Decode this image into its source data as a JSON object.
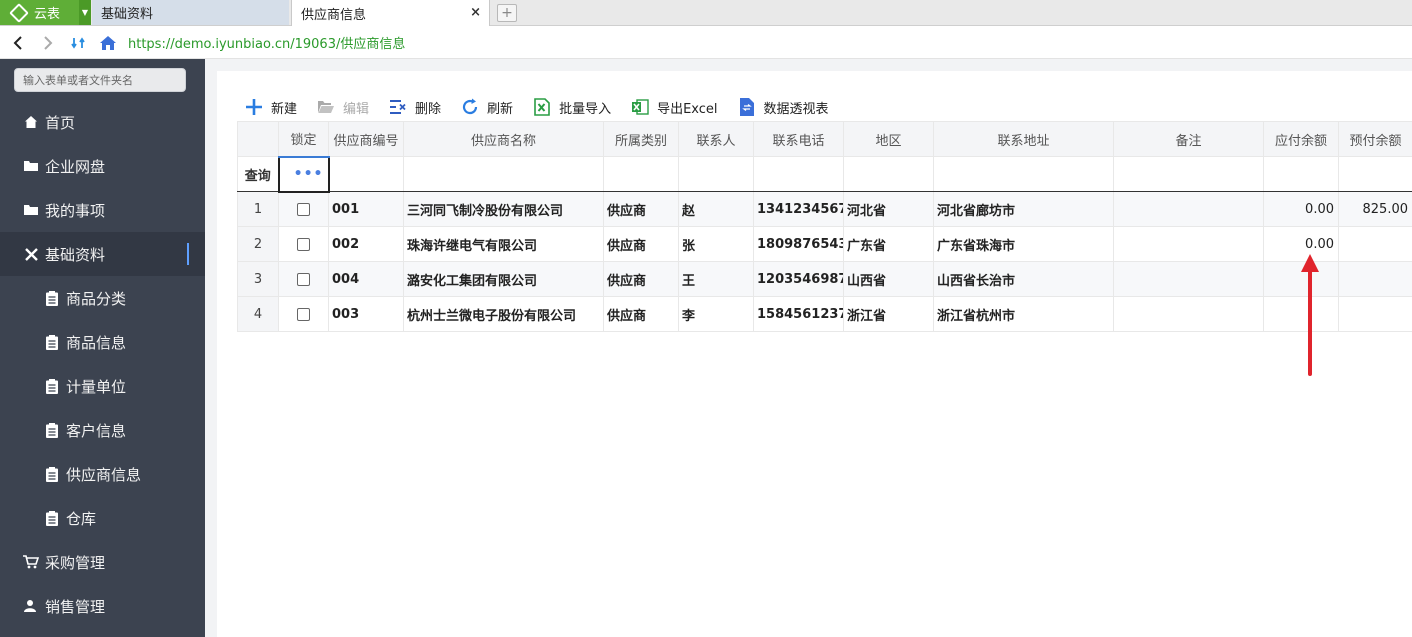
{
  "browser": {
    "app_tab_label": "云表",
    "tabs": [
      {
        "label": "基础资料"
      },
      {
        "label": "供应商信息"
      }
    ],
    "close_glyph": "×",
    "new_tab_glyph": "+",
    "url": "https://demo.iyunbiao.cn/19063/供应商信息"
  },
  "sidebar": {
    "search_placeholder": "输入表单或者文件夹名",
    "items": [
      {
        "label": "首页",
        "icon": "home-icon"
      },
      {
        "label": "企业网盘",
        "icon": "folder-icon"
      },
      {
        "label": "我的事项",
        "icon": "folder-icon"
      },
      {
        "label": "基础资料",
        "icon": "tools-icon"
      },
      {
        "label": "商品分类",
        "icon": "clipboard-icon"
      },
      {
        "label": "商品信息",
        "icon": "clipboard-icon"
      },
      {
        "label": "计量单位",
        "icon": "clipboard-icon"
      },
      {
        "label": "客户信息",
        "icon": "clipboard-icon"
      },
      {
        "label": "供应商信息",
        "icon": "clipboard-icon"
      },
      {
        "label": "仓库",
        "icon": "clipboard-icon"
      },
      {
        "label": "采购管理",
        "icon": "cart-icon"
      },
      {
        "label": "销售管理",
        "icon": "user-icon"
      }
    ]
  },
  "toolbar": {
    "new_label": "新建",
    "edit_label": "编辑",
    "delete_label": "删除",
    "refresh_label": "刷新",
    "import_label": "批量导入",
    "export_label": "导出Excel",
    "pivot_label": "数据透视表"
  },
  "grid": {
    "columns": [
      "锁定",
      "供应商编号",
      "供应商名称",
      "所属类别",
      "联系人",
      "联系电话",
      "地区",
      "联系地址",
      "备注",
      "应付余额",
      "预付余额"
    ],
    "filter_label": "查询",
    "filter_ellipsis": "•••",
    "rows": [
      {
        "no": "1",
        "code": "001",
        "name": "三河同飞制冷股份有限公司",
        "category": "供应商",
        "contact": "赵",
        "phone": "1341234567",
        "region": "河北省",
        "address": "河北省廊坊市",
        "remark": "",
        "payable": "0.00",
        "prepaid": "825.00"
      },
      {
        "no": "2",
        "code": "002",
        "name": "珠海许继电气有限公司",
        "category": "供应商",
        "contact": "张",
        "phone": "1809876543",
        "region": "广东省",
        "address": "广东省珠海市",
        "remark": "",
        "payable": "0.00",
        "prepaid": ""
      },
      {
        "no": "3",
        "code": "004",
        "name": "潞安化工集团有限公司",
        "category": "供应商",
        "contact": "王",
        "phone": "1203546987",
        "region": "山西省",
        "address": "山西省长治市",
        "remark": "",
        "payable": "",
        "prepaid": ""
      },
      {
        "no": "4",
        "code": "003",
        "name": "杭州士兰微电子股份有限公司",
        "category": "供应商",
        "contact": "李",
        "phone": "1584561237",
        "region": "浙江省",
        "address": "浙江省杭州市",
        "remark": "",
        "payable": "",
        "prepaid": ""
      }
    ]
  },
  "colors": {
    "app_green": "#5fae37",
    "sidebar_bg": "#3c4350",
    "accent_blue": "#3a7bd5",
    "arrow_red": "#e0242c"
  }
}
